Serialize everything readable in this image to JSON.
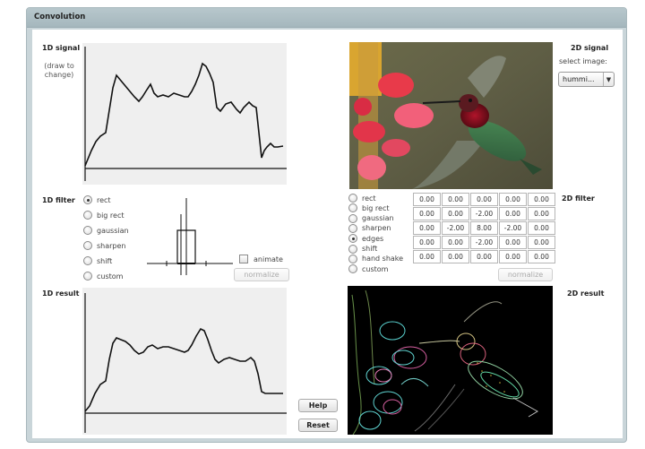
{
  "window": {
    "title": "Convolution"
  },
  "signal1d": {
    "label": "1D signal",
    "hint_line1": "(draw to",
    "hint_line2": "change)"
  },
  "signal2d": {
    "label": "2D signal",
    "select_label": "select image:",
    "select_value": "hummi...",
    "select_arrow_icon": "chevron-down-icon"
  },
  "filter1d": {
    "label": "1D filter",
    "options": [
      "rect",
      "big rect",
      "gaussian",
      "sharpen",
      "shift",
      "custom"
    ],
    "selected": "rect",
    "animate_label": "animate",
    "animate_checked": false,
    "normalize_label": "normalize"
  },
  "filter2d": {
    "label": "2D filter",
    "options": [
      "rect",
      "big rect",
      "gaussian",
      "sharpen",
      "edges",
      "shift",
      "hand shake",
      "custom"
    ],
    "selected": "edges",
    "normalize_label": "normalize",
    "kernel": [
      [
        "0.00",
        "0.00",
        "0.00",
        "0.00",
        "0.00"
      ],
      [
        "0.00",
        "0.00",
        "-2.00",
        "0.00",
        "0.00"
      ],
      [
        "0.00",
        "-2.00",
        "8.00",
        "-2.00",
        "0.00"
      ],
      [
        "0.00",
        "0.00",
        "-2.00",
        "0.00",
        "0.00"
      ],
      [
        "0.00",
        "0.00",
        "0.00",
        "0.00",
        "0.00"
      ]
    ]
  },
  "result1d": {
    "label": "1D result"
  },
  "result2d": {
    "label": "2D result"
  },
  "buttons": {
    "help": "Help",
    "reset": "Reset"
  },
  "colors": {
    "titlebar": "#aebfc4",
    "plot_bg": "#efefef",
    "edge_cyan": "#5fd3d0",
    "edge_pink": "#d86aa0"
  }
}
